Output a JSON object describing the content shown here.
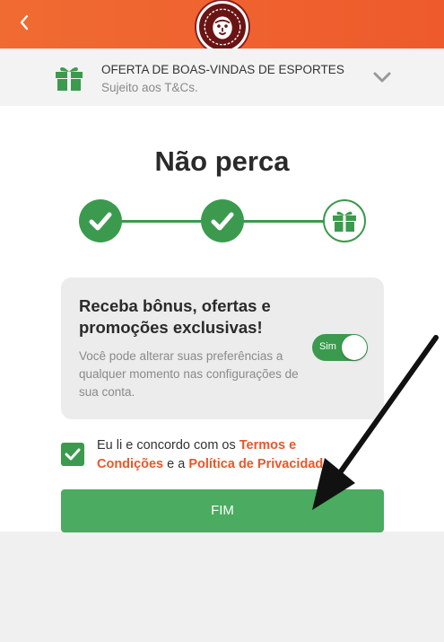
{
  "header": {
    "back_glyph": "<",
    "logo_icon": "lion-logo-icon"
  },
  "offer": {
    "title": "OFERTA DE BOAS-VINDAS DE ESPORTES",
    "terms": "Sujeito aos T&Cs.",
    "gift_icon": "gift-icon",
    "expand_icon": "chevron-down-icon"
  },
  "main": {
    "title": "Não perca",
    "steps": [
      {
        "state": "done",
        "icon": "check-icon"
      },
      {
        "state": "done",
        "icon": "check-icon"
      },
      {
        "state": "current",
        "icon": "gift-icon"
      }
    ]
  },
  "preferences": {
    "title": "Receba bônus, ofertas e promoções exclusivas!",
    "description": "Você pode alterar suas preferências a qualquer momento nas configurações de sua conta.",
    "toggle_label": "Sim",
    "toggle_on": true
  },
  "consent": {
    "text_before": "Eu li e concordo com os ",
    "terms_link": "Termos e Condições",
    "text_middle": " e a ",
    "privacy_link": "Política de Privacidade",
    "checked": true
  },
  "actions": {
    "finish_label": "FIM"
  },
  "colors": {
    "brand_orange": "#ee5a2c",
    "brand_green": "#3b9a4e",
    "button_green": "#4aab61",
    "link_orange": "#e8582a"
  }
}
